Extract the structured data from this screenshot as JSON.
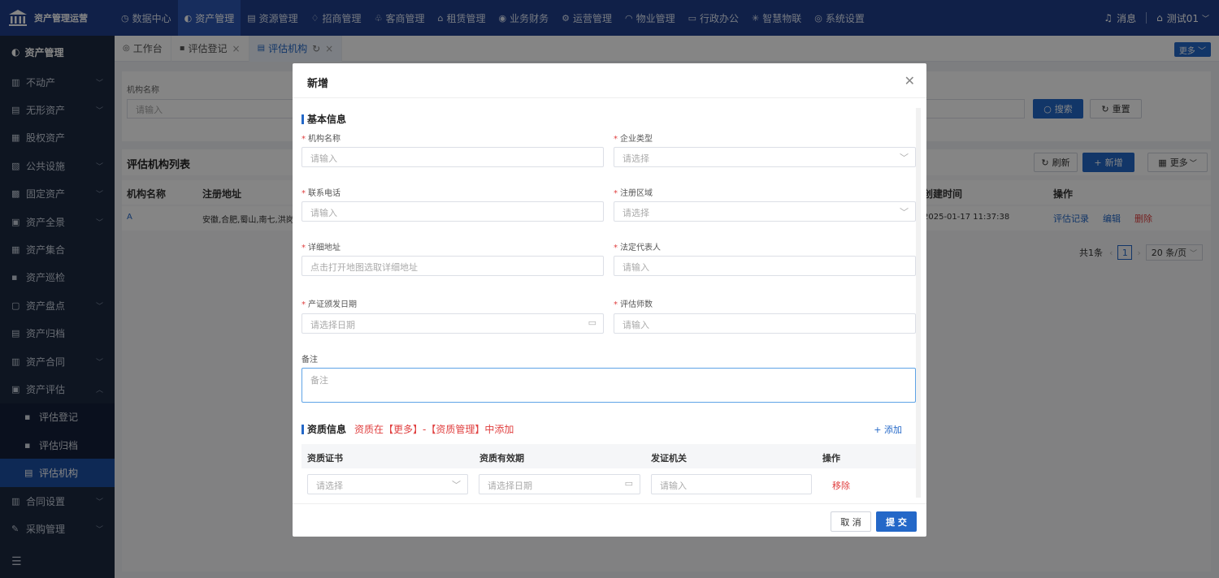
{
  "topbar": {
    "app_title": "资产管理运营",
    "nav": [
      {
        "icon": "◷",
        "label": "数据中心",
        "active": false
      },
      {
        "icon": "◐",
        "label": "资产管理",
        "active": true
      },
      {
        "icon": "▤",
        "label": "资源管理",
        "active": false
      },
      {
        "icon": "♢",
        "label": "招商管理",
        "active": false
      },
      {
        "icon": "♧",
        "label": "客商管理",
        "active": false
      },
      {
        "icon": "⌂",
        "label": "租赁管理",
        "active": false
      },
      {
        "icon": "◉",
        "label": "业务财务",
        "active": false
      },
      {
        "icon": "⚙",
        "label": "运营管理",
        "active": false
      },
      {
        "icon": "◠",
        "label": "物业管理",
        "active": false
      },
      {
        "icon": "▭",
        "label": "行政办公",
        "active": false
      },
      {
        "icon": "✳",
        "label": "智慧物联",
        "active": false
      },
      {
        "icon": "◎",
        "label": "系统设置",
        "active": false
      }
    ],
    "message_label": "消息",
    "user_label": "测试01"
  },
  "sidebar": {
    "header": "资产管理",
    "items": [
      {
        "icon": "▥",
        "label": "不动产",
        "arrow": "﹀",
        "sub": false,
        "active": false
      },
      {
        "icon": "▤",
        "label": "无形资产",
        "arrow": "﹀",
        "sub": false,
        "active": false
      },
      {
        "icon": "▦",
        "label": "股权资产",
        "arrow": "",
        "sub": false,
        "active": false
      },
      {
        "icon": "▧",
        "label": "公共设施",
        "arrow": "﹀",
        "sub": false,
        "active": false
      },
      {
        "icon": "▩",
        "label": "固定资产",
        "arrow": "﹀",
        "sub": false,
        "active": false
      },
      {
        "icon": "▣",
        "label": "资产全景",
        "arrow": "﹀",
        "sub": false,
        "active": false
      },
      {
        "icon": "▦",
        "label": "资产集合",
        "arrow": "",
        "sub": false,
        "active": false
      },
      {
        "icon": "▪",
        "label": "资产巡检",
        "arrow": "",
        "sub": false,
        "active": false
      },
      {
        "icon": "▢",
        "label": "资产盘点",
        "arrow": "﹀",
        "sub": false,
        "active": false
      },
      {
        "icon": "▤",
        "label": "资产归档",
        "arrow": "",
        "sub": false,
        "active": false
      },
      {
        "icon": "▥",
        "label": "资产合同",
        "arrow": "﹀",
        "sub": false,
        "active": false
      },
      {
        "icon": "▣",
        "label": "资产评估",
        "arrow": "︿",
        "sub": false,
        "active": false
      },
      {
        "icon": "▪",
        "label": "评估登记",
        "arrow": "",
        "sub": true,
        "active": false
      },
      {
        "icon": "▪",
        "label": "评估归档",
        "arrow": "",
        "sub": true,
        "active": false
      },
      {
        "icon": "▤",
        "label": "评估机构",
        "arrow": "",
        "sub": true,
        "active": true
      },
      {
        "icon": "▥",
        "label": "合同设置",
        "arrow": "﹀",
        "sub": false,
        "active": false
      },
      {
        "icon": "✎",
        "label": "采购管理",
        "arrow": "﹀",
        "sub": false,
        "active": false
      }
    ],
    "collapse_icon": "☰"
  },
  "tabs": [
    {
      "icon": "◎",
      "label": "工作台",
      "closable": false,
      "active": false
    },
    {
      "icon": "▪",
      "label": "评估登记",
      "closable": true,
      "active": false
    },
    {
      "icon": "▤",
      "label": "评估机构",
      "closable": true,
      "active": true
    }
  ],
  "tabs_more": "更多 ﹀",
  "filter": {
    "label": "机构名称",
    "placeholder": "请输入",
    "search_button": "搜索",
    "reset_button": "重置"
  },
  "list": {
    "title": "评估机构列表",
    "refresh_button": "刷新",
    "add_button": "新增",
    "more_button": "更多",
    "columns": {
      "name": "机构名称",
      "address": "注册地址",
      "created": "创建时间",
      "ops": "操作"
    },
    "rows": [
      {
        "name": "A",
        "address": "安徽,合肥,蜀山,南七,洪岗",
        "created": "2025-01-17 11:37:38",
        "op_record": "评估记录",
        "op_edit": "编辑",
        "op_delete": "删除"
      }
    ],
    "pager": {
      "total": "共1条",
      "page": "1",
      "page_size": "20 条/页"
    }
  },
  "modal": {
    "title": "新增",
    "basic_section": "基本信息",
    "fields": {
      "org_name": {
        "label": "机构名称",
        "placeholder": "请输入"
      },
      "company_type": {
        "label": "企业类型",
        "placeholder": "请选择"
      },
      "phone": {
        "label": "联系电话",
        "placeholder": "请输入"
      },
      "region": {
        "label": "注册区域",
        "placeholder": "请选择"
      },
      "address": {
        "label": "详细地址",
        "placeholder": "点击打开地图选取详细地址"
      },
      "legal_rep": {
        "label": "法定代表人",
        "placeholder": "请输入"
      },
      "cert_date": {
        "label": "产证颁发日期",
        "placeholder": "请选择日期"
      },
      "appraiser_count": {
        "label": "评估师数",
        "placeholder": "请输入"
      },
      "remark": {
        "label": "备注",
        "placeholder": "备注"
      }
    },
    "qual_section": "资质信息",
    "qual_note": "资质在【更多】-【资质管理】中添加",
    "qual_add": "+ 添加",
    "qual_columns": {
      "cert": "资质证书",
      "validity": "资质有效期",
      "issuer": "发证机关",
      "ops": "操作"
    },
    "qual_row": {
      "cert_placeholder": "请选择",
      "validity_placeholder": "请选择日期",
      "issuer_placeholder": "请输入",
      "remove": "移除"
    },
    "cancel_button": "取 消",
    "submit_button": "提 交"
  },
  "colors": {
    "primary": "#2468c8",
    "topbar": "#1f3f8a",
    "sidebar": "#1b2940",
    "danger": "#e04040"
  }
}
